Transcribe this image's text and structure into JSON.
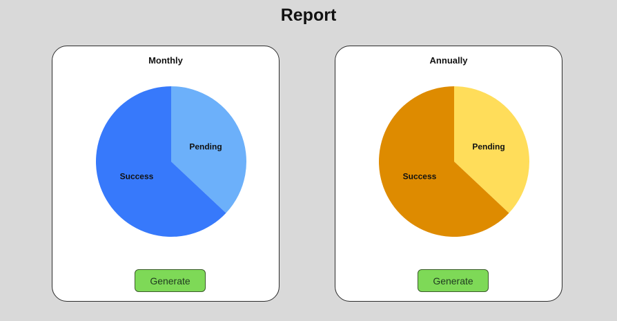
{
  "header": {
    "title": "Report"
  },
  "cards": [
    {
      "title": "Monthly",
      "button_label": "Generate",
      "chart_data": {
        "type": "pie",
        "title": "",
        "slices": [
          {
            "label": "Pending",
            "value": 37,
            "color": "#6cb0fa"
          },
          {
            "label": "Success",
            "value": 63,
            "color": "#3779fb"
          }
        ]
      }
    },
    {
      "title": "Annually",
      "button_label": "Generate",
      "chart_data": {
        "type": "pie",
        "title": "",
        "slices": [
          {
            "label": "Pending",
            "value": 37,
            "color": "#ffdd5a"
          },
          {
            "label": "Success",
            "value": 63,
            "color": "#de8b00"
          }
        ]
      }
    }
  ]
}
